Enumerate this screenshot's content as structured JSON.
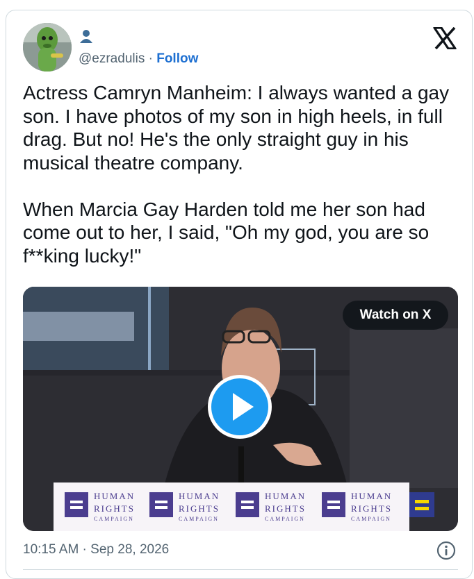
{
  "author": {
    "handle": "@ezradulis",
    "separator": "·",
    "follow_label": "Follow"
  },
  "tweet": {
    "text": "Actress Camryn Manheim: I always wanted a gay son. I have photos of my son in high heels, in full drag. But no! He's the only straight guy in his musical theatre company.\n\nWhen Marcia Gay Harden told me her son had come out to her, I said, \"Oh my god, you are so f**king lucky!\""
  },
  "media": {
    "watch_label": "Watch on X",
    "placards": [
      {
        "line1": "HUMAN",
        "line2": "RIGHTS",
        "line3": "CAMPAIGN"
      },
      {
        "line1": "HUMAN",
        "line2": "RIGHTS",
        "line3": "CAMPAIGN"
      },
      {
        "line1": "HUMAN",
        "line2": "RIGHTS",
        "line3": "CAMPAIGN"
      },
      {
        "line1": "HUMAN",
        "line2": "RIGHTS",
        "line3": "CAMPAIGN"
      }
    ]
  },
  "footer": {
    "timestamp": "10:15 AM · Sep 28, 2026"
  },
  "colors": {
    "link_blue": "#1d6fd1",
    "muted": "#536471",
    "hrc_blue": "#4b3d8f",
    "hrc_yellow": "#f5d600",
    "play_blue": "#1d9bf0"
  },
  "icons": [
    "avatar",
    "person-icon",
    "x-logo-icon",
    "play-icon",
    "info-icon"
  ]
}
